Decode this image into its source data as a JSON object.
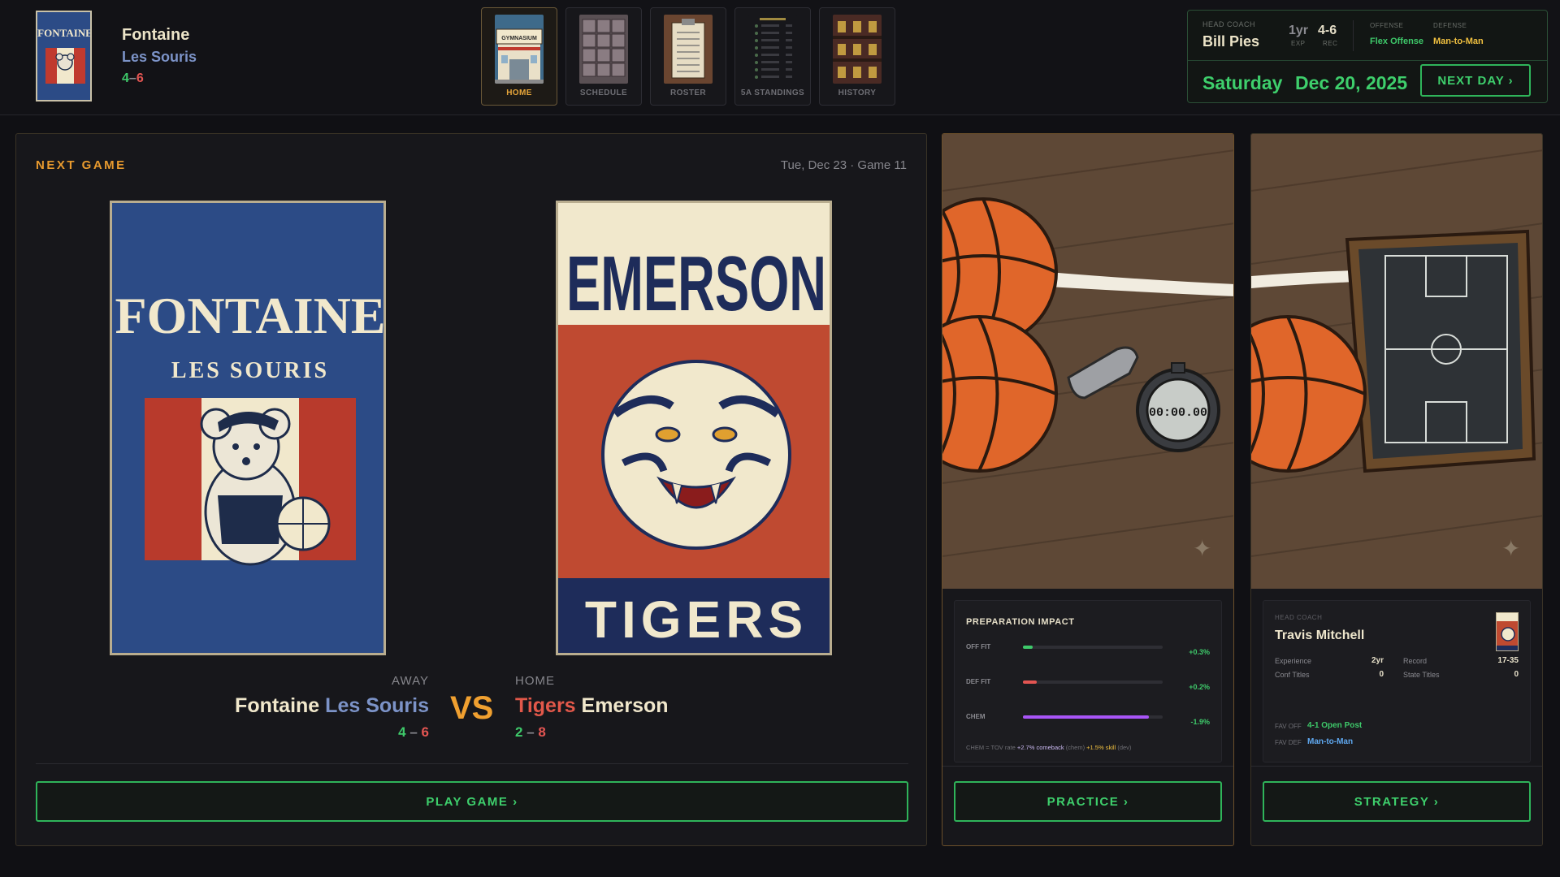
{
  "team": {
    "name": "Fontaine",
    "mascot": "Les Souris",
    "record_w": "4",
    "record_l": "6"
  },
  "nav": {
    "tabs": [
      {
        "label": "HOME"
      },
      {
        "label": "SCHEDULE"
      },
      {
        "label": "ROSTER"
      },
      {
        "label": "5A STANDINGS"
      },
      {
        "label": "HISTORY"
      }
    ]
  },
  "coach": {
    "label": "HEAD COACH",
    "name": "Bill Pies",
    "exp_value": "1yr",
    "exp_label": "EXP",
    "rec_value": "4-6",
    "rec_label": "REC",
    "offense_label": "OFFENSE",
    "offense_value": "Flex Offense",
    "defense_label": "DEFENSE",
    "defense_value": "Man-to-Man"
  },
  "date": {
    "weekday": "Saturday",
    "full": "Dec 20, 2025",
    "next_day_label": "NEXT DAY ›"
  },
  "next_game": {
    "section_label": "NEXT GAME",
    "meta": "Tue, Dec 23 · Game 11",
    "away": {
      "side_label": "AWAY",
      "city": "Fontaine",
      "mascot": "Les Souris",
      "record_w": "4",
      "record_l": "6",
      "poster_title": "FONTAINE",
      "poster_subtitle": "LES SOURIS"
    },
    "vs": "VS",
    "home": {
      "side_label": "HOME",
      "mascot": "Tigers",
      "city": "Emerson",
      "record_w": "2",
      "record_l": "8",
      "poster_title": "EMERSON",
      "poster_subtitle": "TIGERS"
    },
    "play_label": "PLAY GAME ›"
  },
  "practice": {
    "title": "PREPARATION IMPACT",
    "rows": [
      {
        "label": "OFF FIT",
        "value": "+0.3%",
        "level": 0.07,
        "color": "#3ec96a",
        "val_color": "#3ec96a"
      },
      {
        "label": "DEF FIT",
        "value": "+0.2%",
        "level": 0.1,
        "color": "#e35552",
        "val_color": "#3ec96a"
      },
      {
        "label": "CHEM",
        "value": "-1.9%",
        "level": 0.9,
        "color": "#a855f7",
        "val_color": "#3ec96a"
      }
    ],
    "note_prefix": "CHEM = TOV rate",
    "note_a": "+2.7% comeback",
    "note_a_suffix": "(chem)",
    "note_b": "+1.5% skill",
    "note_b_suffix": "(dev)",
    "button_label": "PRACTICE ›"
  },
  "strategy": {
    "coach_label": "HEAD COACH",
    "coach_name": "Travis Mitchell",
    "experience_label": "Experience",
    "experience_value": "2yr",
    "record_label": "Record",
    "record_value": "17-35",
    "conf_label": "Conf Titles",
    "conf_value": "0",
    "state_label": "State Titles",
    "state_value": "0",
    "fav_off_label": "FAV OFF",
    "fav_off_value": "4-1 Open Post",
    "fav_def_label": "FAV DEF",
    "fav_def_value": "Man-to-Man",
    "button_label": "STRATEGY ›"
  },
  "art_text": {
    "gym_sign": "GYMNASIUM",
    "stopwatch": "00:00.00"
  },
  "colors": {
    "accent_green": "#3ecf6c",
    "accent_orange": "#e89a2e",
    "win": "#3ec96a",
    "loss": "#e35552"
  }
}
